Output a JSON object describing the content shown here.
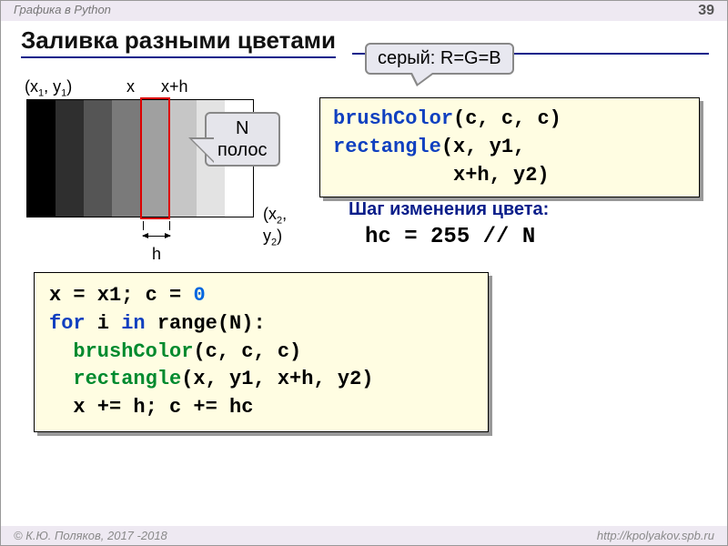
{
  "header": {
    "left": "Графика в Python",
    "page": "39"
  },
  "title": "Заливка разными цветами",
  "callouts": {
    "gray": "серый: R=G=B",
    "n_line1": "N",
    "n_line2": "полос"
  },
  "diagram": {
    "p1": "(x",
    "p1s": "1",
    "p1m": ", y",
    "p1s2": "1",
    "p1e": ")",
    "x": "x",
    "xh": "x+h",
    "p2": "(x",
    "p2s": "2",
    "p2m": ", y",
    "p2s2": "2",
    "p2e": ")",
    "h": "h"
  },
  "code1": {
    "l1a": "brushColor",
    "l1b": "(c, c, c)",
    "l2a": "rectangle",
    "l2b": "(x, y1,",
    "l3": "          x+h, y2)"
  },
  "step_label": "Шаг изменения цвета:",
  "hc": "hc = 255 // N",
  "code2": {
    "l1": "x = x1; c = ",
    "l1n": "0",
    "l2a": "for",
    "l2b": " i ",
    "l2c": "in",
    "l2d": " range(N):",
    "l3a": "  brushColor",
    "l3b": "(c, c, c)",
    "l4a": "  rectangle",
    "l4b": "(x, y1, x+h, y2)",
    "l5": "  x += h; c += hc"
  },
  "footer": {
    "left": "© К.Ю. Поляков, 2017 -2018",
    "right": "http://kpolyakov.spb.ru"
  }
}
